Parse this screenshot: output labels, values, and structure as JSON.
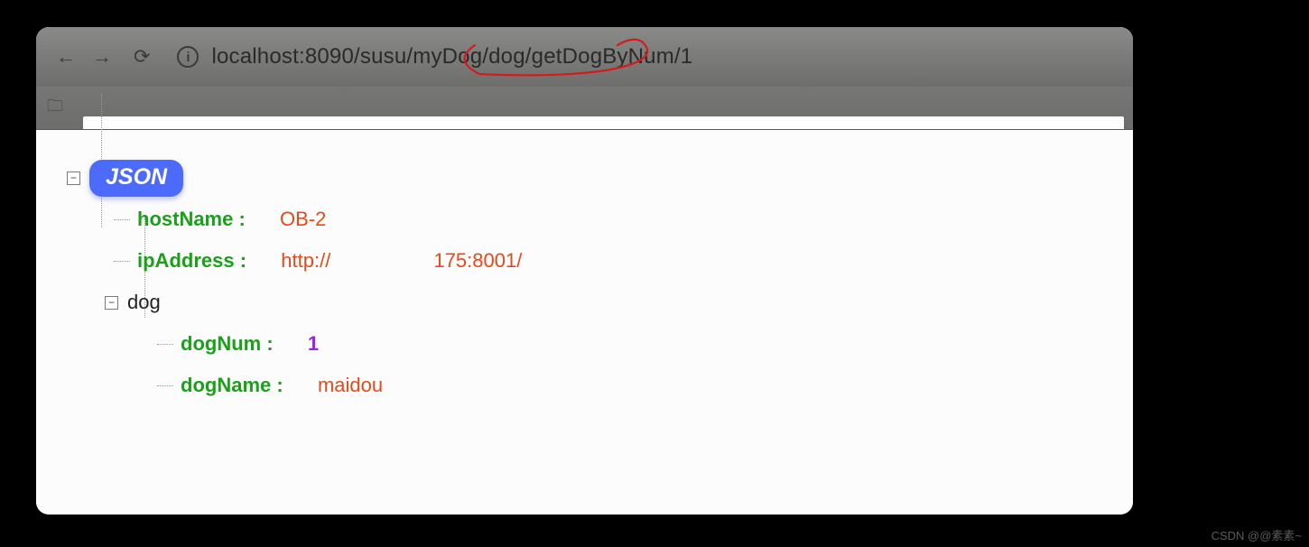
{
  "url": "localhost:8090/susu/myDog/dog/getDogByNum/1",
  "tree": {
    "rootLabel": "JSON",
    "hostNameKey": "hostName :",
    "hostNameVal": "OB-2",
    "ipAddressKey": "ipAddress :",
    "ipAddressPrefix": "http://",
    "ipAddressSuffix": "175:8001/",
    "dogLabel": "dog",
    "dogNumKey": "dogNum :",
    "dogNumVal": "1",
    "dogNameKey": "dogName :",
    "dogNameVal": "maidou"
  },
  "watermark": "CSDN @@素素~"
}
